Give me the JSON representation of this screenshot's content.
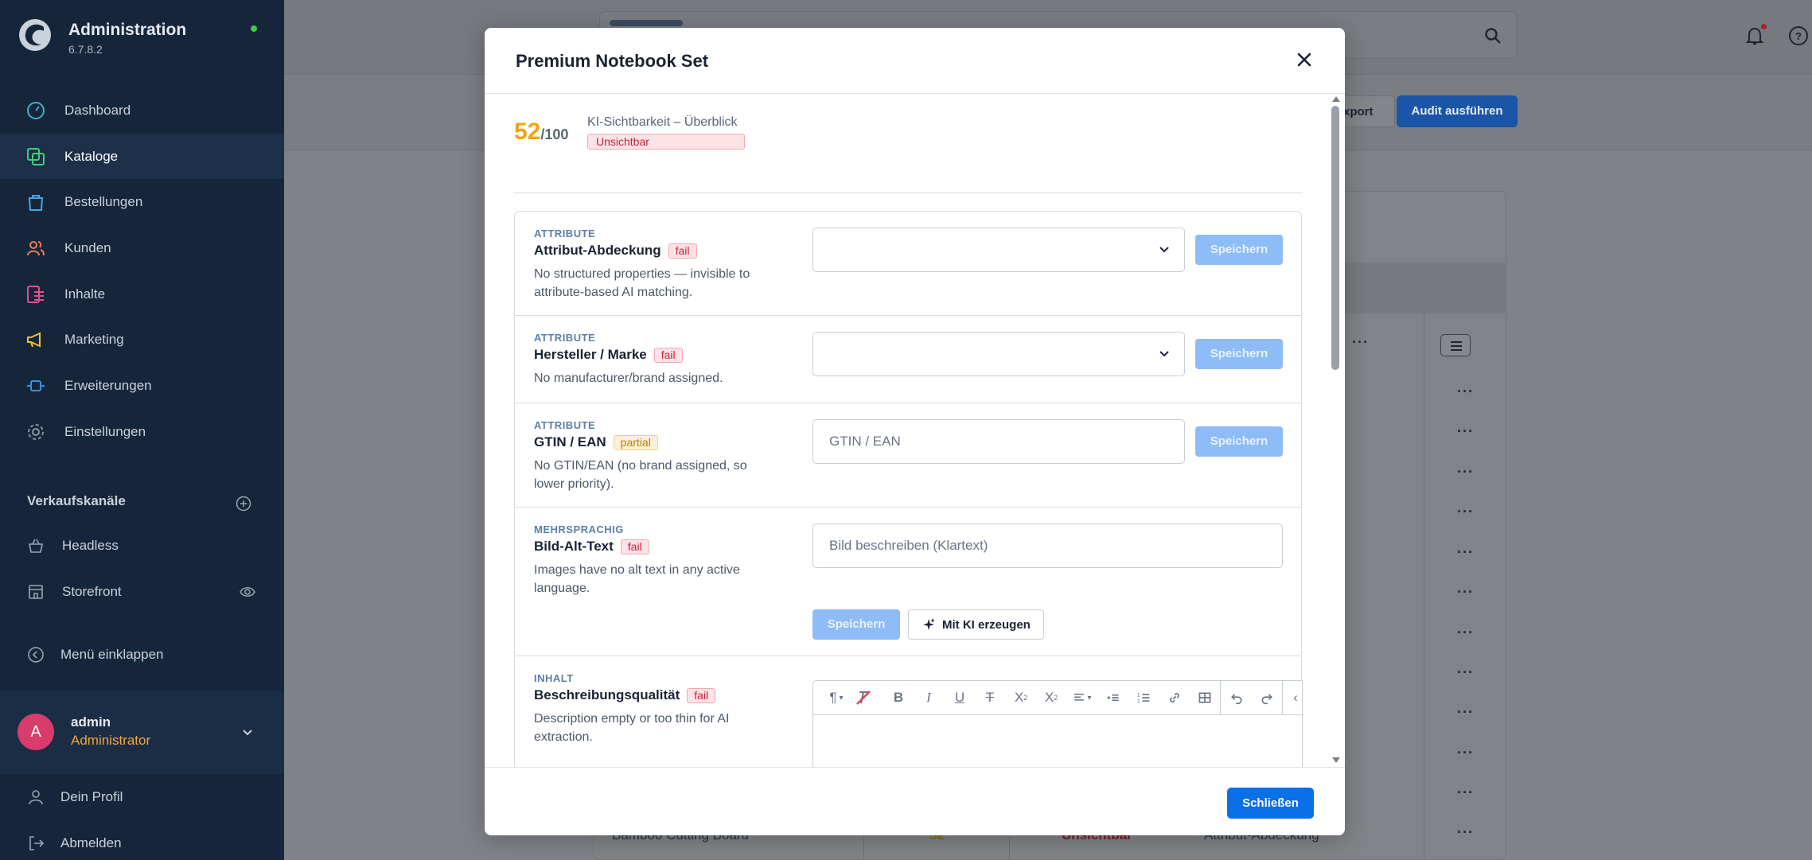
{
  "app": {
    "title": "Administration",
    "version": "6.7.8.2"
  },
  "sidebar": {
    "nav": [
      {
        "label": "Dashboard",
        "icon": "dashboard-icon",
        "active": false
      },
      {
        "label": "Kataloge",
        "icon": "catalog-icon",
        "active": true
      },
      {
        "label": "Bestellungen",
        "icon": "orders-icon",
        "active": false
      },
      {
        "label": "Kunden",
        "icon": "customers-icon",
        "active": false
      },
      {
        "label": "Inhalte",
        "icon": "content-icon",
        "active": false
      },
      {
        "label": "Marketing",
        "icon": "marketing-icon",
        "active": false
      },
      {
        "label": "Erweiterungen",
        "icon": "extensions-icon",
        "active": false
      },
      {
        "label": "Einstellungen",
        "icon": "settings-icon",
        "active": false
      }
    ],
    "sales_channels_title": "Verkaufskanäle",
    "channels": [
      {
        "label": "Headless",
        "icon": "basket-icon"
      },
      {
        "label": "Storefront",
        "icon": "storefront-icon"
      }
    ],
    "collapse_label": "Menü einklappen",
    "user": {
      "initial": "A",
      "name": "admin",
      "role": "Administrator"
    },
    "footer": [
      {
        "label": "Dein Profil",
        "icon": "profile-icon"
      },
      {
        "label": "Abmelden",
        "icon": "logout-icon"
      }
    ]
  },
  "background": {
    "export_label": "xport",
    "audit_label": "Audit ausführen",
    "row_name": "Bamboo Cutting Board",
    "row_score": "52",
    "row_status": "Unsichtbar",
    "row_issue": "Attribut-Abdeckung",
    "row_menu": "···"
  },
  "modal": {
    "title": "Premium Notebook Set",
    "score": "52",
    "score_max": "/100",
    "score_label": "KI-Sichtbarkeit – Überblick",
    "score_status": "Unsichtbar",
    "close_button": "Schließen",
    "save_label": "Speichern",
    "ai_label": "Mit KI erzeugen",
    "checks": [
      {
        "category": "ATTRIBUTE",
        "title": "Attribut-Abdeckung",
        "status": "fail",
        "description": "No structured properties — invisible to attribute-based AI matching.",
        "control": "select"
      },
      {
        "category": "ATTRIBUTE",
        "title": "Hersteller / Marke",
        "status": "fail",
        "description": "No manufacturer/brand assigned.",
        "control": "select"
      },
      {
        "category": "ATTRIBUTE",
        "title": "GTIN / EAN",
        "status": "partial",
        "description": "No GTIN/EAN (no brand assigned, so lower priority).",
        "control": "input",
        "placeholder": "GTIN / EAN"
      },
      {
        "category": "MEHRSPRACHIG",
        "title": "Bild-Alt-Text",
        "status": "fail",
        "description": "Images have no alt text in any active language.",
        "control": "input",
        "placeholder": "Bild beschreiben (Klartext)"
      },
      {
        "category": "INHALT",
        "title": "Beschreibungsqualität",
        "status": "fail",
        "description": "Description empty or too thin for AI extraction.",
        "control": "editor"
      }
    ]
  },
  "colors": {
    "sidebar_bg": "#16263a",
    "accent_blue": "#0b6fe8",
    "score_orange": "#f2a50c",
    "fail_red": "#c4213b",
    "partial_orange": "#c07a05"
  }
}
